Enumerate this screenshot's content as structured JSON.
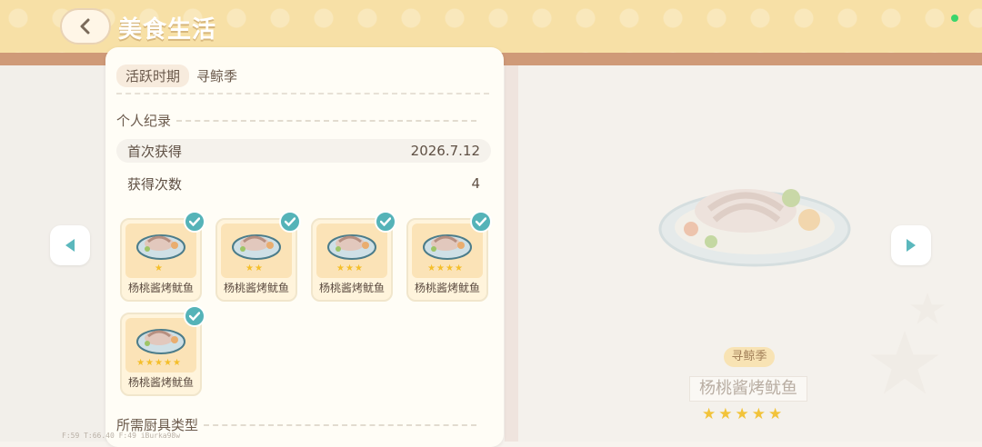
{
  "header": {
    "title": "美食生活"
  },
  "panel": {
    "period_label": "活跃时期",
    "period_value": "寻鲸季",
    "personal_record_title": "个人纪录",
    "records": [
      {
        "label": "首次获得",
        "value": "2026.7.12"
      },
      {
        "label": "获得次数",
        "value": "4"
      }
    ],
    "cards": [
      {
        "name": "杨桃酱烤鱿鱼",
        "stars": "★",
        "star_count": 1,
        "obtained": true
      },
      {
        "name": "杨桃酱烤鱿鱼",
        "stars": "★★",
        "star_count": 2,
        "obtained": true
      },
      {
        "name": "杨桃酱烤鱿鱼",
        "stars": "★★★",
        "star_count": 3,
        "obtained": true
      },
      {
        "name": "杨桃酱烤鱿鱼",
        "stars": "★★★★",
        "star_count": 4,
        "obtained": true
      },
      {
        "name": "杨桃酱烤鱿鱼",
        "stars": "★★★★★",
        "star_count": 5,
        "obtained": true
      }
    ],
    "tools_title": "所需厨具类型"
  },
  "detail": {
    "season_tag": "寻鲸季",
    "dish_name": "杨桃酱烤鱿鱼",
    "stars": "★★★★★",
    "star_count": 5
  },
  "debug_text": "F:59  T:66.40  F:49  iBurka98w",
  "colors": {
    "accent": "#55b3b8",
    "header": "#f7e0a6",
    "star": "#f4be2a"
  }
}
